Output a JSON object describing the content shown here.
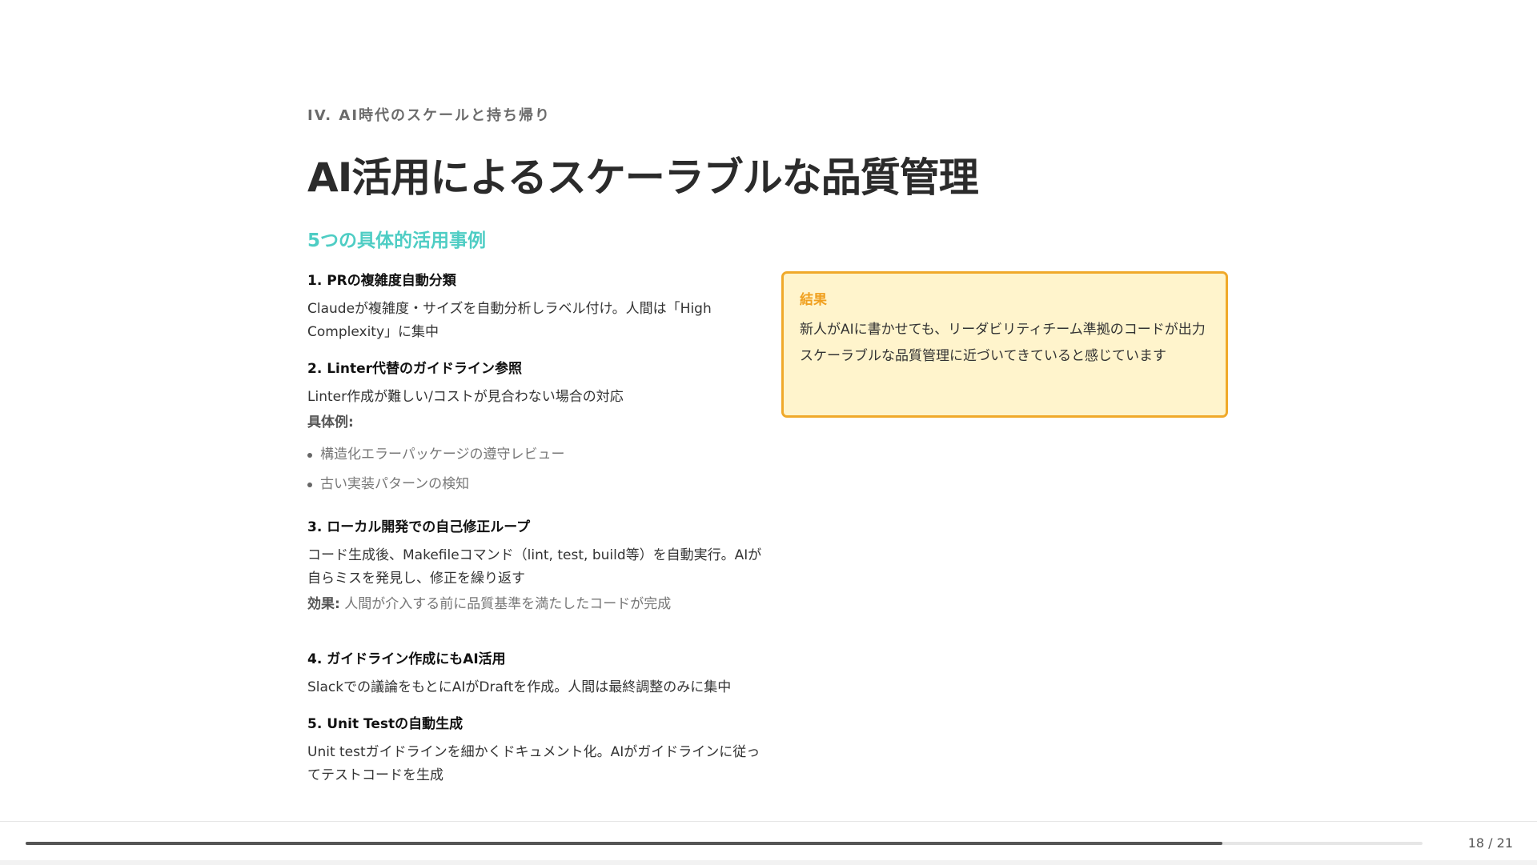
{
  "slide": {
    "section_label": "IV. AI時代のスケールと持ち帰り",
    "title": "AI活用によるスケーラブルな品質管理",
    "subtitle": "5つの具体的活用事例",
    "cases": [
      {
        "title": "1. PRの複雑度自動分類",
        "desc": "Claudeが複雑度・サイズを自動分析しラベル付け。人間は「High Complexity」に集中"
      },
      {
        "title": "2. Linter代替のガイドライン参照",
        "desc": "Linter作成が難しい/コストが見合わない場合の対応",
        "examples_label": "具体例:",
        "examples": [
          "構造化エラーパッケージの遵守レビュー",
          "古い実装パターンの検知"
        ]
      },
      {
        "title": "3. ローカル開発での自己修正ループ",
        "desc": "コード生成後、Makefileコマンド（lint, test, build等）を自動実行。AIが自らミスを発見し、修正を繰り返す",
        "effect_label": "効果:",
        "effect": " 人間が介入する前に品質基準を満たしたコードが完成"
      },
      {
        "title": "4. ガイドライン作成にもAI活用",
        "desc": "Slackでの議論をもとにAIがDraftを作成。人間は最終調整のみに集中"
      },
      {
        "title": "5. Unit Testの自動生成",
        "desc": "Unit testガイドラインを細かくドキュメント化。AIがガイドラインに従ってテストコードを生成"
      }
    ],
    "result": {
      "title": "結果",
      "lines": [
        "新人がAIに書かせても、リーダビリティチーム準拠のコードが出力",
        "スケーラブルな品質管理に近づいてきていると感じています"
      ]
    }
  },
  "footer": {
    "page_counter": "18 / 21",
    "progress": 0.857
  },
  "colors": {
    "accent_teal": "#4ecdc4",
    "result_border": "#f0a92a",
    "result_bg": "#fff4cc",
    "result_title": "#f0a020"
  }
}
